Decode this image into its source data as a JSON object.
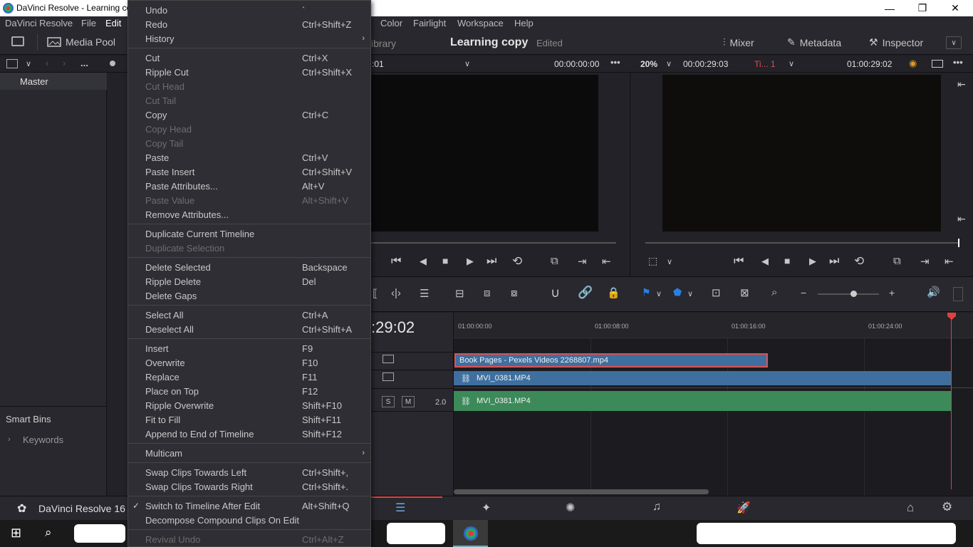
{
  "window": {
    "title": "DaVinci Resolve - Learning co",
    "minimize": "—",
    "maximize": "❐",
    "close": "✕"
  },
  "menubar": {
    "items": [
      "DaVinci Resolve",
      "File",
      "Edit",
      "Color",
      "Fairlight",
      "Workspace",
      "Help"
    ]
  },
  "toolbar": {
    "media_pool": "Media Pool",
    "library_partial": "ibrary",
    "project_name": "Learning copy",
    "project_status": "Edited",
    "mixer": "Mixer",
    "metadata": "Metadata",
    "inspector": "Inspector"
  },
  "subbar": {
    "more": "...",
    "src_tc_partial": ":01",
    "src_timecode": "00:00:00:00",
    "zoom": "20%",
    "duration": "00:00:29:03",
    "timeline_name": "Ti... 1",
    "pgm_timecode": "01:00:29:02"
  },
  "left_panel": {
    "master": "Master",
    "smart_bins": "Smart Bins",
    "keywords": "Keywords"
  },
  "timeline": {
    "current_tc_partial": ":29:02",
    "ruler": [
      "01:00:00:00",
      "01:00:08:00",
      "01:00:16:00",
      "01:00:24:00"
    ],
    "clip_v2": "Book Pages - Pexels Videos 2268807.mp4",
    "clip_v1": "MVI_0381.MP4",
    "clip_a1": "MVI_0381.MP4",
    "a1_level": "2.0",
    "solo": "S",
    "mute": "M"
  },
  "pagebar": {
    "app_name": "DaVinci Resolve 16"
  },
  "edit_menu": {
    "items": [
      {
        "label": "Undo",
        "shortcut": "`",
        "disabled": false
      },
      {
        "label": "Redo",
        "shortcut": "Ctrl+Shift+Z",
        "disabled": false
      },
      {
        "label": "History",
        "shortcut": "",
        "disabled": false,
        "submenu": true
      },
      {
        "label": "Cut",
        "shortcut": "Ctrl+X",
        "disabled": false
      },
      {
        "label": "Ripple Cut",
        "shortcut": "Ctrl+Shift+X",
        "disabled": false
      },
      {
        "label": "Cut Head",
        "shortcut": "",
        "disabled": true
      },
      {
        "label": "Cut Tail",
        "shortcut": "",
        "disabled": true
      },
      {
        "label": "Copy",
        "shortcut": "Ctrl+C",
        "disabled": false
      },
      {
        "label": "Copy Head",
        "shortcut": "",
        "disabled": true
      },
      {
        "label": "Copy Tail",
        "shortcut": "",
        "disabled": true
      },
      {
        "label": "Paste",
        "shortcut": "Ctrl+V",
        "disabled": false
      },
      {
        "label": "Paste Insert",
        "shortcut": "Ctrl+Shift+V",
        "disabled": false
      },
      {
        "label": "Paste Attributes...",
        "shortcut": "Alt+V",
        "disabled": false
      },
      {
        "label": "Paste Value",
        "shortcut": "Alt+Shift+V",
        "disabled": true
      },
      {
        "label": "Remove Attributes...",
        "shortcut": "",
        "disabled": false
      },
      {
        "label": "Duplicate Current Timeline",
        "shortcut": "",
        "disabled": false
      },
      {
        "label": "Duplicate Selection",
        "shortcut": "",
        "disabled": true
      },
      {
        "label": "Delete Selected",
        "shortcut": "Backspace",
        "disabled": false
      },
      {
        "label": "Ripple Delete",
        "shortcut": "Del",
        "disabled": false
      },
      {
        "label": "Delete Gaps",
        "shortcut": "",
        "disabled": false
      },
      {
        "label": "Select All",
        "shortcut": "Ctrl+A",
        "disabled": false
      },
      {
        "label": "Deselect All",
        "shortcut": "Ctrl+Shift+A",
        "disabled": false
      },
      {
        "label": "Insert",
        "shortcut": "F9",
        "disabled": false
      },
      {
        "label": "Overwrite",
        "shortcut": "F10",
        "disabled": false
      },
      {
        "label": "Replace",
        "shortcut": "F11",
        "disabled": false
      },
      {
        "label": "Place on Top",
        "shortcut": "F12",
        "disabled": false
      },
      {
        "label": "Ripple Overwrite",
        "shortcut": "Shift+F10",
        "disabled": false
      },
      {
        "label": "Fit to Fill",
        "shortcut": "Shift+F11",
        "disabled": false
      },
      {
        "label": "Append to End of Timeline",
        "shortcut": "Shift+F12",
        "disabled": false
      },
      {
        "label": "Multicam",
        "shortcut": "",
        "disabled": false,
        "submenu": true
      },
      {
        "label": "Swap Clips Towards Left",
        "shortcut": "Ctrl+Shift+,",
        "disabled": false
      },
      {
        "label": "Swap Clips Towards Right",
        "shortcut": "Ctrl+Shift+.",
        "disabled": false
      },
      {
        "label": "Switch to Timeline After Edit",
        "shortcut": "Alt+Shift+Q",
        "disabled": false,
        "checked": true
      },
      {
        "label": "Decompose Compound Clips On Edit",
        "shortcut": "",
        "disabled": false
      },
      {
        "label": "Revival Undo",
        "shortcut": "Ctrl+Alt+Z",
        "disabled": true
      }
    ]
  },
  "colors": {
    "clip_video": "#3e6f9f",
    "clip_audio": "#3c8a5a",
    "playhead": "#e04040",
    "selection": "#e05050"
  }
}
